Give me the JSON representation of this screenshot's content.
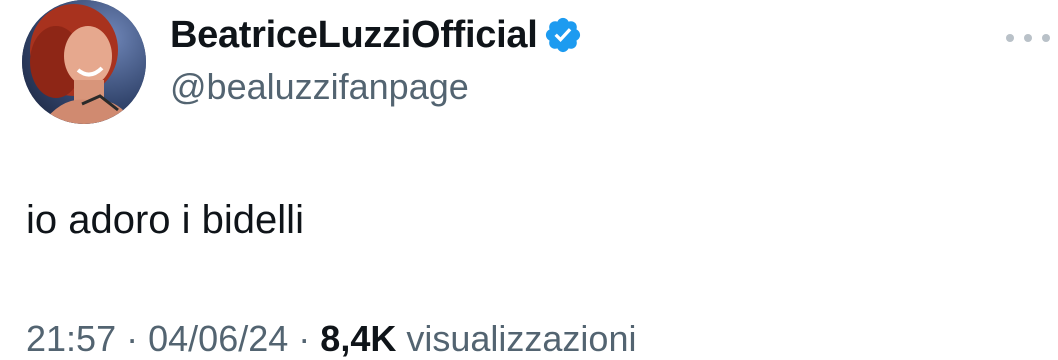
{
  "tweet": {
    "author": {
      "display_name": "BeatriceLuzziOfficial",
      "handle": "@bealuzzifanpage",
      "verified_icon": "verified-badge-icon",
      "verified_color": "#1d9bf0"
    },
    "text": "io adoro i bidelli",
    "meta": {
      "time": "21:57",
      "separator": "·",
      "date": "04/06/24",
      "views_count": "8,4K",
      "views_label": "visualizzazioni"
    },
    "more_icon": "more-dots-icon"
  }
}
